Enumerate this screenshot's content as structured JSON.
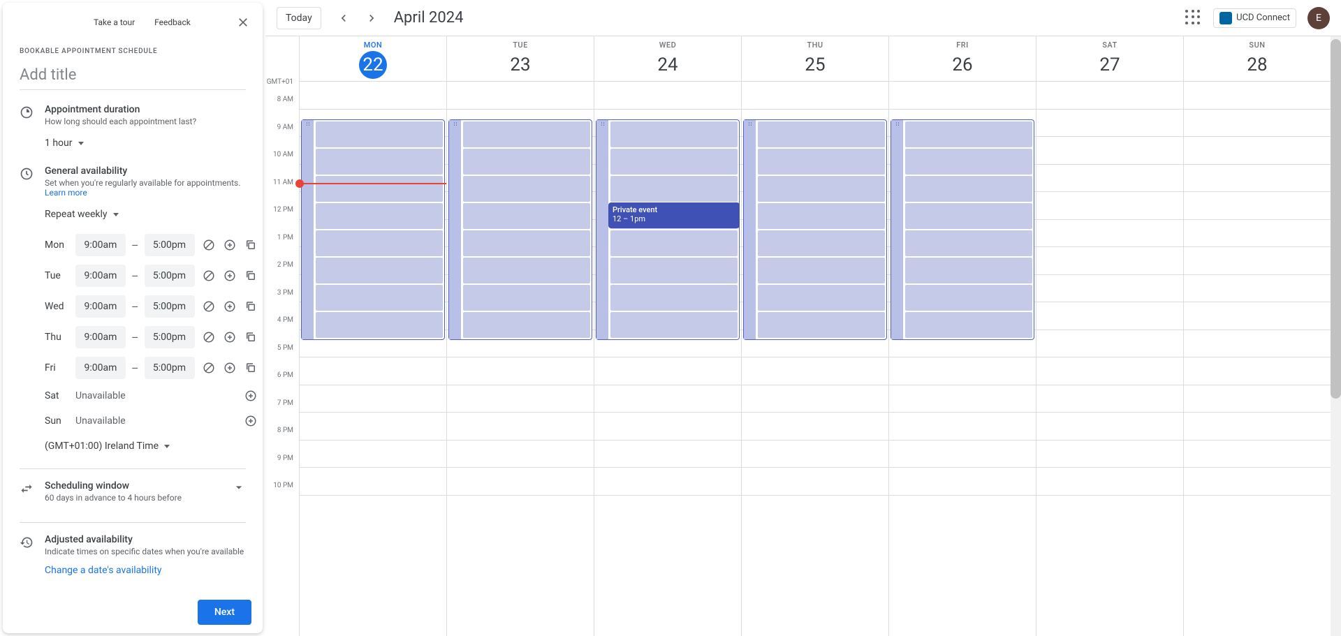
{
  "sidebar": {
    "tabs": [
      "Take a tour",
      "Feedback"
    ],
    "subtitle": "Bookable Appointment Schedule",
    "title_placeholder": "Add title",
    "duration": {
      "title": "Appointment duration",
      "desc": "How long should each appointment last?",
      "value": "1 hour"
    },
    "availability": {
      "title": "General availability",
      "desc": "Set when you're regularly available for appointments. ",
      "learn_more": "Learn more",
      "repeat": "Repeat weekly",
      "days": [
        {
          "label": "Mon",
          "start": "9:00am",
          "end": "5:00pm",
          "available": true
        },
        {
          "label": "Tue",
          "start": "9:00am",
          "end": "5:00pm",
          "available": true
        },
        {
          "label": "Wed",
          "start": "9:00am",
          "end": "5:00pm",
          "available": true
        },
        {
          "label": "Thu",
          "start": "9:00am",
          "end": "5:00pm",
          "available": true
        },
        {
          "label": "Fri",
          "start": "9:00am",
          "end": "5:00pm",
          "available": true
        },
        {
          "label": "Sat",
          "unavailable_text": "Unavailable",
          "available": false
        },
        {
          "label": "Sun",
          "unavailable_text": "Unavailable",
          "available": false
        }
      ],
      "timezone": "(GMT+01:00) Ireland Time"
    },
    "scheduling": {
      "title": "Scheduling window",
      "desc": "60 days in advance to 4 hours before"
    },
    "adjusted": {
      "title": "Adjusted availability",
      "desc": "Indicate times on specific dates when you're available",
      "link": "Change a date's availability"
    },
    "next_button": "Next"
  },
  "topbar": {
    "today": "Today",
    "month": "April 2024",
    "org": "UCD Connect",
    "avatar": "E"
  },
  "calendar": {
    "tz": "GMT+01",
    "hours": [
      "8 AM",
      "9 AM",
      "10 AM",
      "11 AM",
      "12 PM",
      "1 PM",
      "2 PM",
      "3 PM",
      "4 PM",
      "5 PM",
      "6 PM",
      "7 PM",
      "8 PM",
      "9 PM",
      "10 PM"
    ],
    "days": [
      {
        "name": "MON",
        "num": "22",
        "today": true,
        "avail": true
      },
      {
        "name": "TUE",
        "num": "23",
        "today": false,
        "avail": true
      },
      {
        "name": "WED",
        "num": "24",
        "today": false,
        "avail": true,
        "event": {
          "title": "Private event",
          "time": "12 – 1pm"
        }
      },
      {
        "name": "THU",
        "num": "25",
        "today": false,
        "avail": true
      },
      {
        "name": "FRI",
        "num": "26",
        "today": false,
        "avail": true
      },
      {
        "name": "SAT",
        "num": "27",
        "today": false,
        "avail": false
      },
      {
        "name": "SUN",
        "num": "28",
        "today": false,
        "avail": false
      }
    ]
  }
}
